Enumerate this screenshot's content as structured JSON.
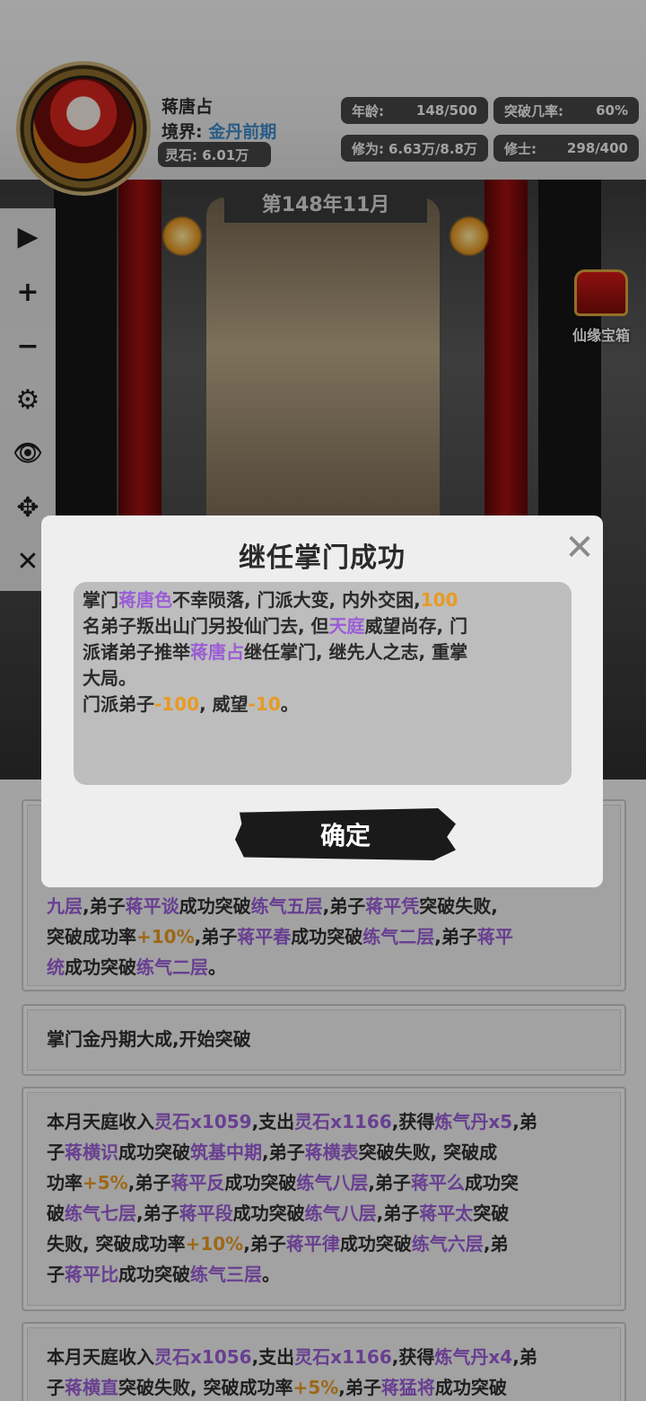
{
  "player": {
    "name": "蒋唐占",
    "realm_label": "境界:",
    "realm_value": "金丹前期",
    "stone": "灵石: 6.01万"
  },
  "stats": {
    "age_label": "年龄:",
    "age_value": "148/500",
    "breakthrough_label": "突破几率:",
    "breakthrough_value": "60%",
    "cultivation_label": "修为:",
    "cultivation_value": "6.63万/8.8万",
    "cultivators_label": "修士:",
    "cultivators_value": "298/400"
  },
  "scene": {
    "date": "第148年11月",
    "chest_label": "仙缘宝箱"
  },
  "toolbar": {
    "play": "▶",
    "plus": "+",
    "minus": "−",
    "settings": "⚙",
    "view": "👁",
    "move": "✥",
    "close": "✕"
  },
  "log": {
    "card1": {
      "t1": "九层",
      "t2": ",弟子",
      "t3": "蒋平谈",
      "t4": "成功突破",
      "t5": "练气五层",
      "t6": ",弟子",
      "t7": "蒋平凭",
      "t8": "突破失败,",
      "t9": "突破成功率",
      "t10": "+10%",
      "t11": ",弟子",
      "t12": "蒋平春",
      "t13": "成功突破",
      "t14": "练气二层",
      "t15": ",弟子",
      "t16": "蒋平",
      "t17": "统",
      "t18": "成功突破",
      "t19": "练气二层",
      "t20": "。"
    },
    "card2": {
      "text": "掌门金丹期大成,开始突破"
    },
    "card3": {
      "a1": "本月天庭收入",
      "a2": "灵石x1059",
      "a3": ",支出",
      "a4": "灵石x1166",
      "a5": ",获得",
      "a6": "炼气丹x5",
      "a7": ",弟",
      "b1": "子",
      "b2": "蒋横识",
      "b3": "成功突破",
      "b4": "筑基中期",
      "b5": ",弟子",
      "b6": "蒋横表",
      "b7": "突破失败, 突破成",
      "c1": "功率",
      "c2": "+5%",
      "c3": ",弟子",
      "c4": "蒋平反",
      "c5": "成功突破",
      "c6": "练气八层",
      "c7": ",弟子",
      "c8": "蒋平么",
      "c9": "成功突",
      "d1": "破",
      "d2": "练气七层",
      "d3": ",弟子",
      "d4": "蒋平段",
      "d5": "成功突破",
      "d6": "练气八层",
      "d7": ",弟子",
      "d8": "蒋平太",
      "d9": "突破",
      "e1": "失败, 突破成功率",
      "e2": "+10%",
      "e3": ",弟子",
      "e4": "蒋平律",
      "e5": "成功突破",
      "e6": "练气六层",
      "e7": ",弟",
      "f1": "子",
      "f2": "蒋平比",
      "f3": "成功突破",
      "f4": "练气三层",
      "f5": "。"
    },
    "card4": {
      "a1": "本月天庭收入",
      "a2": "灵石x1056",
      "a3": ",支出",
      "a4": "灵石x1166",
      "a5": ",获得",
      "a6": "炼气丹x4",
      "a7": ",弟",
      "b1": "子",
      "b2": "蒋横直",
      "b3": "突破失败, 突破成功率",
      "b4": "+5%",
      "b5": ",弟子",
      "b6": "蒋猛将",
      "b7": "成功突破"
    }
  },
  "modal": {
    "title": "继任掌门成功",
    "l1a": "掌门",
    "l1b": "蒋唐色",
    "l1c": "不幸陨落, 门派大变, 内外交困,",
    "l1d": "100",
    "l2a": "名弟子叛出山门另投仙门去, 但",
    "l2b": "天庭",
    "l2c": "威望尚存, 门",
    "l3a": "派诸弟子推举",
    "l3b": "蒋唐占",
    "l3c": "继任掌门, 继先人之志, 重掌",
    "l4": "大局。",
    "l5a": "门派弟子",
    "l5b": "-100",
    "l5c": ", 威望",
    "l5d": "-10",
    "l5e": "。",
    "confirm": "确定",
    "close": "✕"
  },
  "colors": {
    "accent_purple": "#9a5dd6",
    "accent_orange": "#e89a22",
    "realm_blue": "#3d88c8"
  }
}
